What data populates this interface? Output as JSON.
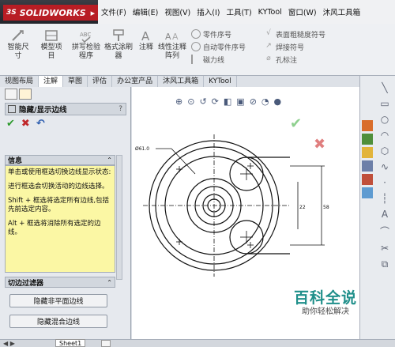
{
  "app": {
    "logo_text": "SOLIDWORKS"
  },
  "menu": [
    "文件(F)",
    "编辑(E)",
    "视图(V)",
    "插入(I)",
    "工具(T)",
    "KYTool",
    "窗口(W)",
    "沐风工具箱"
  ],
  "ribbon": {
    "big_buttons": [
      "智能尺寸",
      "模型项目",
      "拼写检验程序",
      "格式涂刷器",
      "注释",
      "线性注释阵列"
    ],
    "mid_items": [
      "零件序号",
      "自动零件序号",
      "磁力线"
    ],
    "right_items": [
      "表面粗糙度符号",
      "焊接符号",
      "孔标注"
    ]
  },
  "tabs": [
    "视图布局",
    "注解",
    "草图",
    "评估",
    "办公室产品",
    "沐风工具箱",
    "KYTool"
  ],
  "active_tab": "注解",
  "panel": {
    "title": "隐藏/显示边线",
    "help": "?",
    "info_header": "信息",
    "info_lines": [
      "单击或使用框选切换边线显示状态:",
      "进行框选会切换活动的边线选择。",
      "Shift + 框选将选定所有边线,包括先前选定内容。",
      "Alt + 框选将消除所有选定的边线。"
    ],
    "filter_header": "切边过滤器",
    "filter_buttons": [
      "隐藏非平面边线",
      "隐藏混合边线"
    ]
  },
  "drawing": {
    "dim_diameter": "Ø61.0",
    "dim_22": "22",
    "dim_58": "58"
  },
  "status": {
    "sheet_tab": "Sheet1"
  },
  "watermark": {
    "title": "百科全说",
    "subtitle": "助你轻松解决"
  },
  "colors": {
    "accent": "#b81d24",
    "info_bg": "#fbf7a4",
    "check": "#2e9a2e",
    "close": "#c0282b"
  }
}
